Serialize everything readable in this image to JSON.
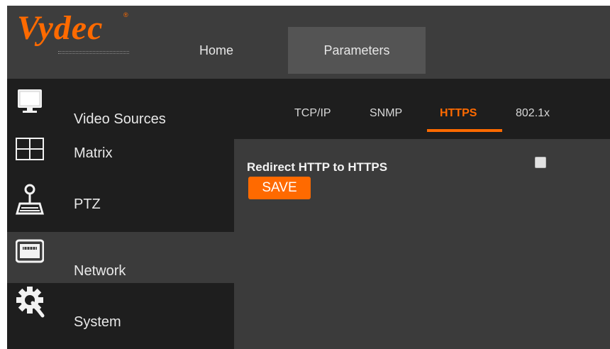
{
  "brand": {
    "name": "Vydec",
    "registered": "®",
    "color": "#ff6a00"
  },
  "header": {
    "nav": [
      {
        "label": "Home"
      },
      {
        "label": "Parameters"
      }
    ]
  },
  "sidebar": {
    "items": [
      {
        "label": "Video Sources",
        "icon": "monitor-icon"
      },
      {
        "label": "Matrix",
        "icon": "grid-icon"
      },
      {
        "label": "PTZ",
        "icon": "joystick-icon"
      },
      {
        "label": "Network",
        "icon": "network-device-icon",
        "active": true
      },
      {
        "label": "System",
        "icon": "gear-wrench-icon"
      }
    ]
  },
  "main": {
    "tabs": [
      {
        "label": "TCP/IP"
      },
      {
        "label": "SNMP"
      },
      {
        "label": "HTTPS",
        "active": true
      },
      {
        "label": "802.1x"
      }
    ],
    "option": {
      "label": "Redirect HTTP to HTTPS",
      "checked": false
    },
    "save_label": "SAVE"
  },
  "colors": {
    "accent": "#ff6a00",
    "sidebar_bg": "#1e1e1e",
    "panel_bg": "#3b3b3b"
  }
}
